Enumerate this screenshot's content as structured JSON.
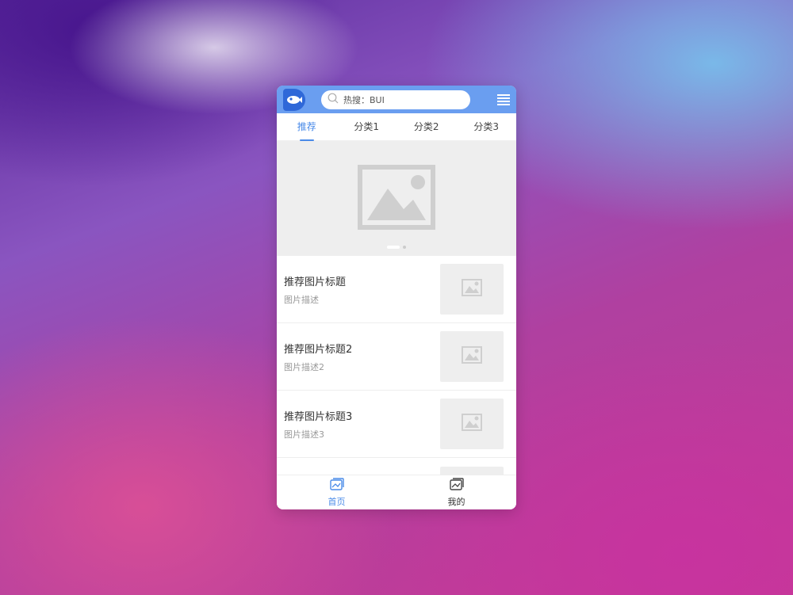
{
  "header": {
    "logo": "bui-fish-logo",
    "search_placeholder": "热搜：BUI",
    "menu_icon": "menu-icon"
  },
  "tabs": [
    {
      "label": "推荐",
      "active": true
    },
    {
      "label": "分类1",
      "active": false
    },
    {
      "label": "分类2",
      "active": false
    },
    {
      "label": "分类3",
      "active": false
    }
  ],
  "banner": {
    "icon": "image-placeholder-icon",
    "slides": 2,
    "active_slide": 1
  },
  "list": [
    {
      "title": "推荐图片标题",
      "desc": "图片描述"
    },
    {
      "title": "推荐图片标题2",
      "desc": "图片描述2"
    },
    {
      "title": "推荐图片标题3",
      "desc": "图片描述3"
    }
  ],
  "tabbar": [
    {
      "label": "首页",
      "icon": "image-icon",
      "active": true
    },
    {
      "label": "我的",
      "icon": "image-icon",
      "active": false
    }
  ],
  "colors": {
    "header_bg": "#6a9ef0",
    "accent": "#4a8be8",
    "placeholder_bg": "#eeeeee"
  }
}
